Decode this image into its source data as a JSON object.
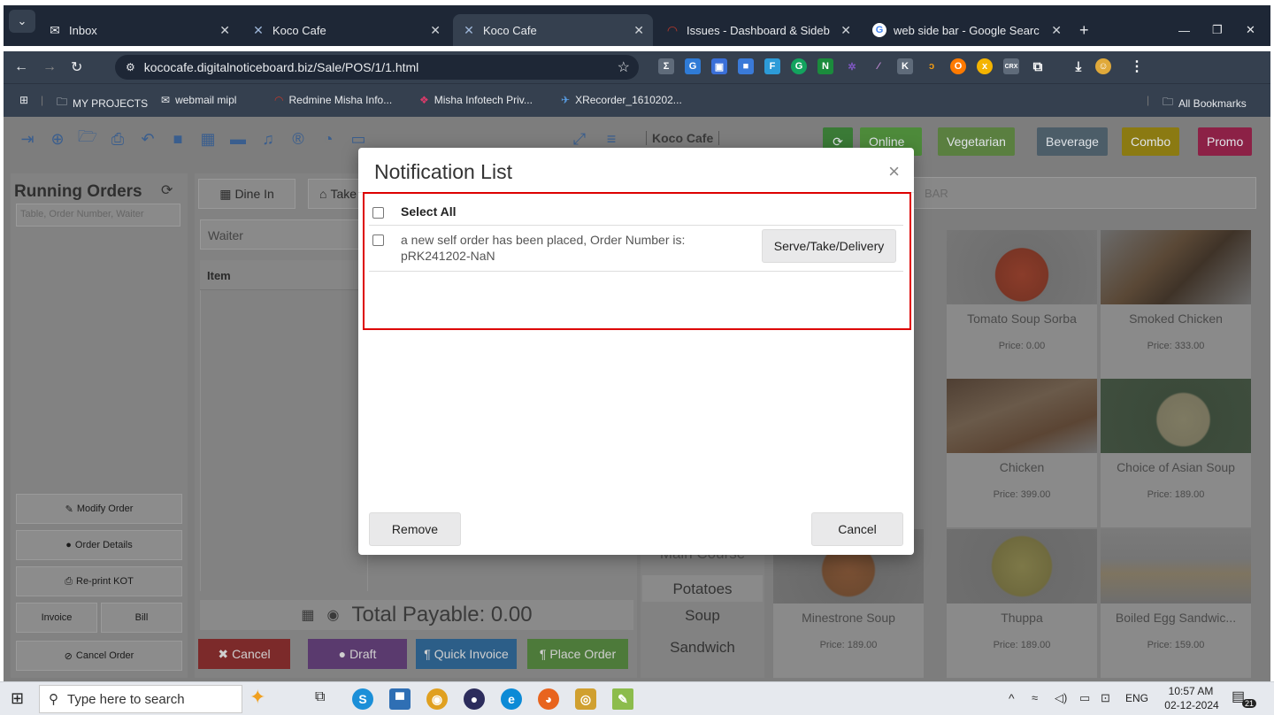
{
  "browser": {
    "tabs": [
      {
        "title": "Inbox",
        "icon": "mail-icon"
      },
      {
        "title": "Koco Cafe",
        "icon": "koco-icon"
      },
      {
        "title": "Koco Cafe",
        "icon": "koco-icon",
        "active": true
      },
      {
        "title": "Issues - Dashboard & Sideb",
        "icon": "redmine-icon"
      },
      {
        "title": "web side bar - Google Searc",
        "icon": "google-icon"
      }
    ],
    "new_tab": "+",
    "url": "kococafe.digitalnoticeboard.biz/Sale/POS/1/1.html",
    "bookmarks": [
      "MY PROJECTS",
      "webmail mipl",
      "Redmine Misha Info...",
      "Misha Infotech Priv...",
      "XRecorder_1610202..."
    ],
    "all_bookmarks": "All Bookmarks"
  },
  "app": {
    "brand": "Koco Cafe",
    "categories": [
      "Online",
      "Vegetarian",
      "Beverage",
      "Combo",
      "Promo"
    ],
    "running_orders_title": "Running Orders",
    "running_orders_placeholder": "Table, Order Number, Waiter",
    "dine_in": "Dine In",
    "take": "Take",
    "waiter_placeholder": "Waiter",
    "item_header": "Item",
    "search_placeholder": "BAR",
    "side_buttons": [
      "Modify Order",
      "Order Details",
      "Re-print KOT"
    ],
    "invoice": "Invoice",
    "bill": "Bill",
    "cancel_order": "Cancel Order",
    "total_payable": "Total Payable: 0.00",
    "actions": [
      "Cancel",
      "Draft",
      "Quick Invoice",
      "Place Order"
    ],
    "category_list": [
      "Main Course",
      "Potatoes",
      "Soup",
      "Sandwich"
    ],
    "foods": [
      {
        "name": "Tomato Soup Sorba",
        "price": "Price: 0.00"
      },
      {
        "name": "Smoked Chicken",
        "price": "Price: 333.00"
      },
      {
        "name": "Chicken",
        "price": "Price: 399.00"
      },
      {
        "name": "Choice of Asian Soup",
        "price": "Price: 189.00"
      },
      {
        "name": "Minestrone Soup",
        "price": "Price: 189.00"
      },
      {
        "name": "Thuppa",
        "price": "Price: 189.00"
      },
      {
        "name": "Boiled Egg Sandwic...",
        "price": "Price: 159.00"
      }
    ]
  },
  "modal": {
    "title": "Notification List",
    "close": "×",
    "select_all": "Select All",
    "notification_text": "a new self order has been placed, Order Number is: pRK241202-NaN",
    "serve_button": "Serve/Take/Delivery",
    "remove_button": "Remove",
    "cancel_button": "Cancel"
  },
  "taskbar": {
    "search_placeholder": "Type here to search",
    "time": "10:57 AM",
    "date": "02-12-2024",
    "lang": "ENG",
    "notif_count": "21"
  }
}
